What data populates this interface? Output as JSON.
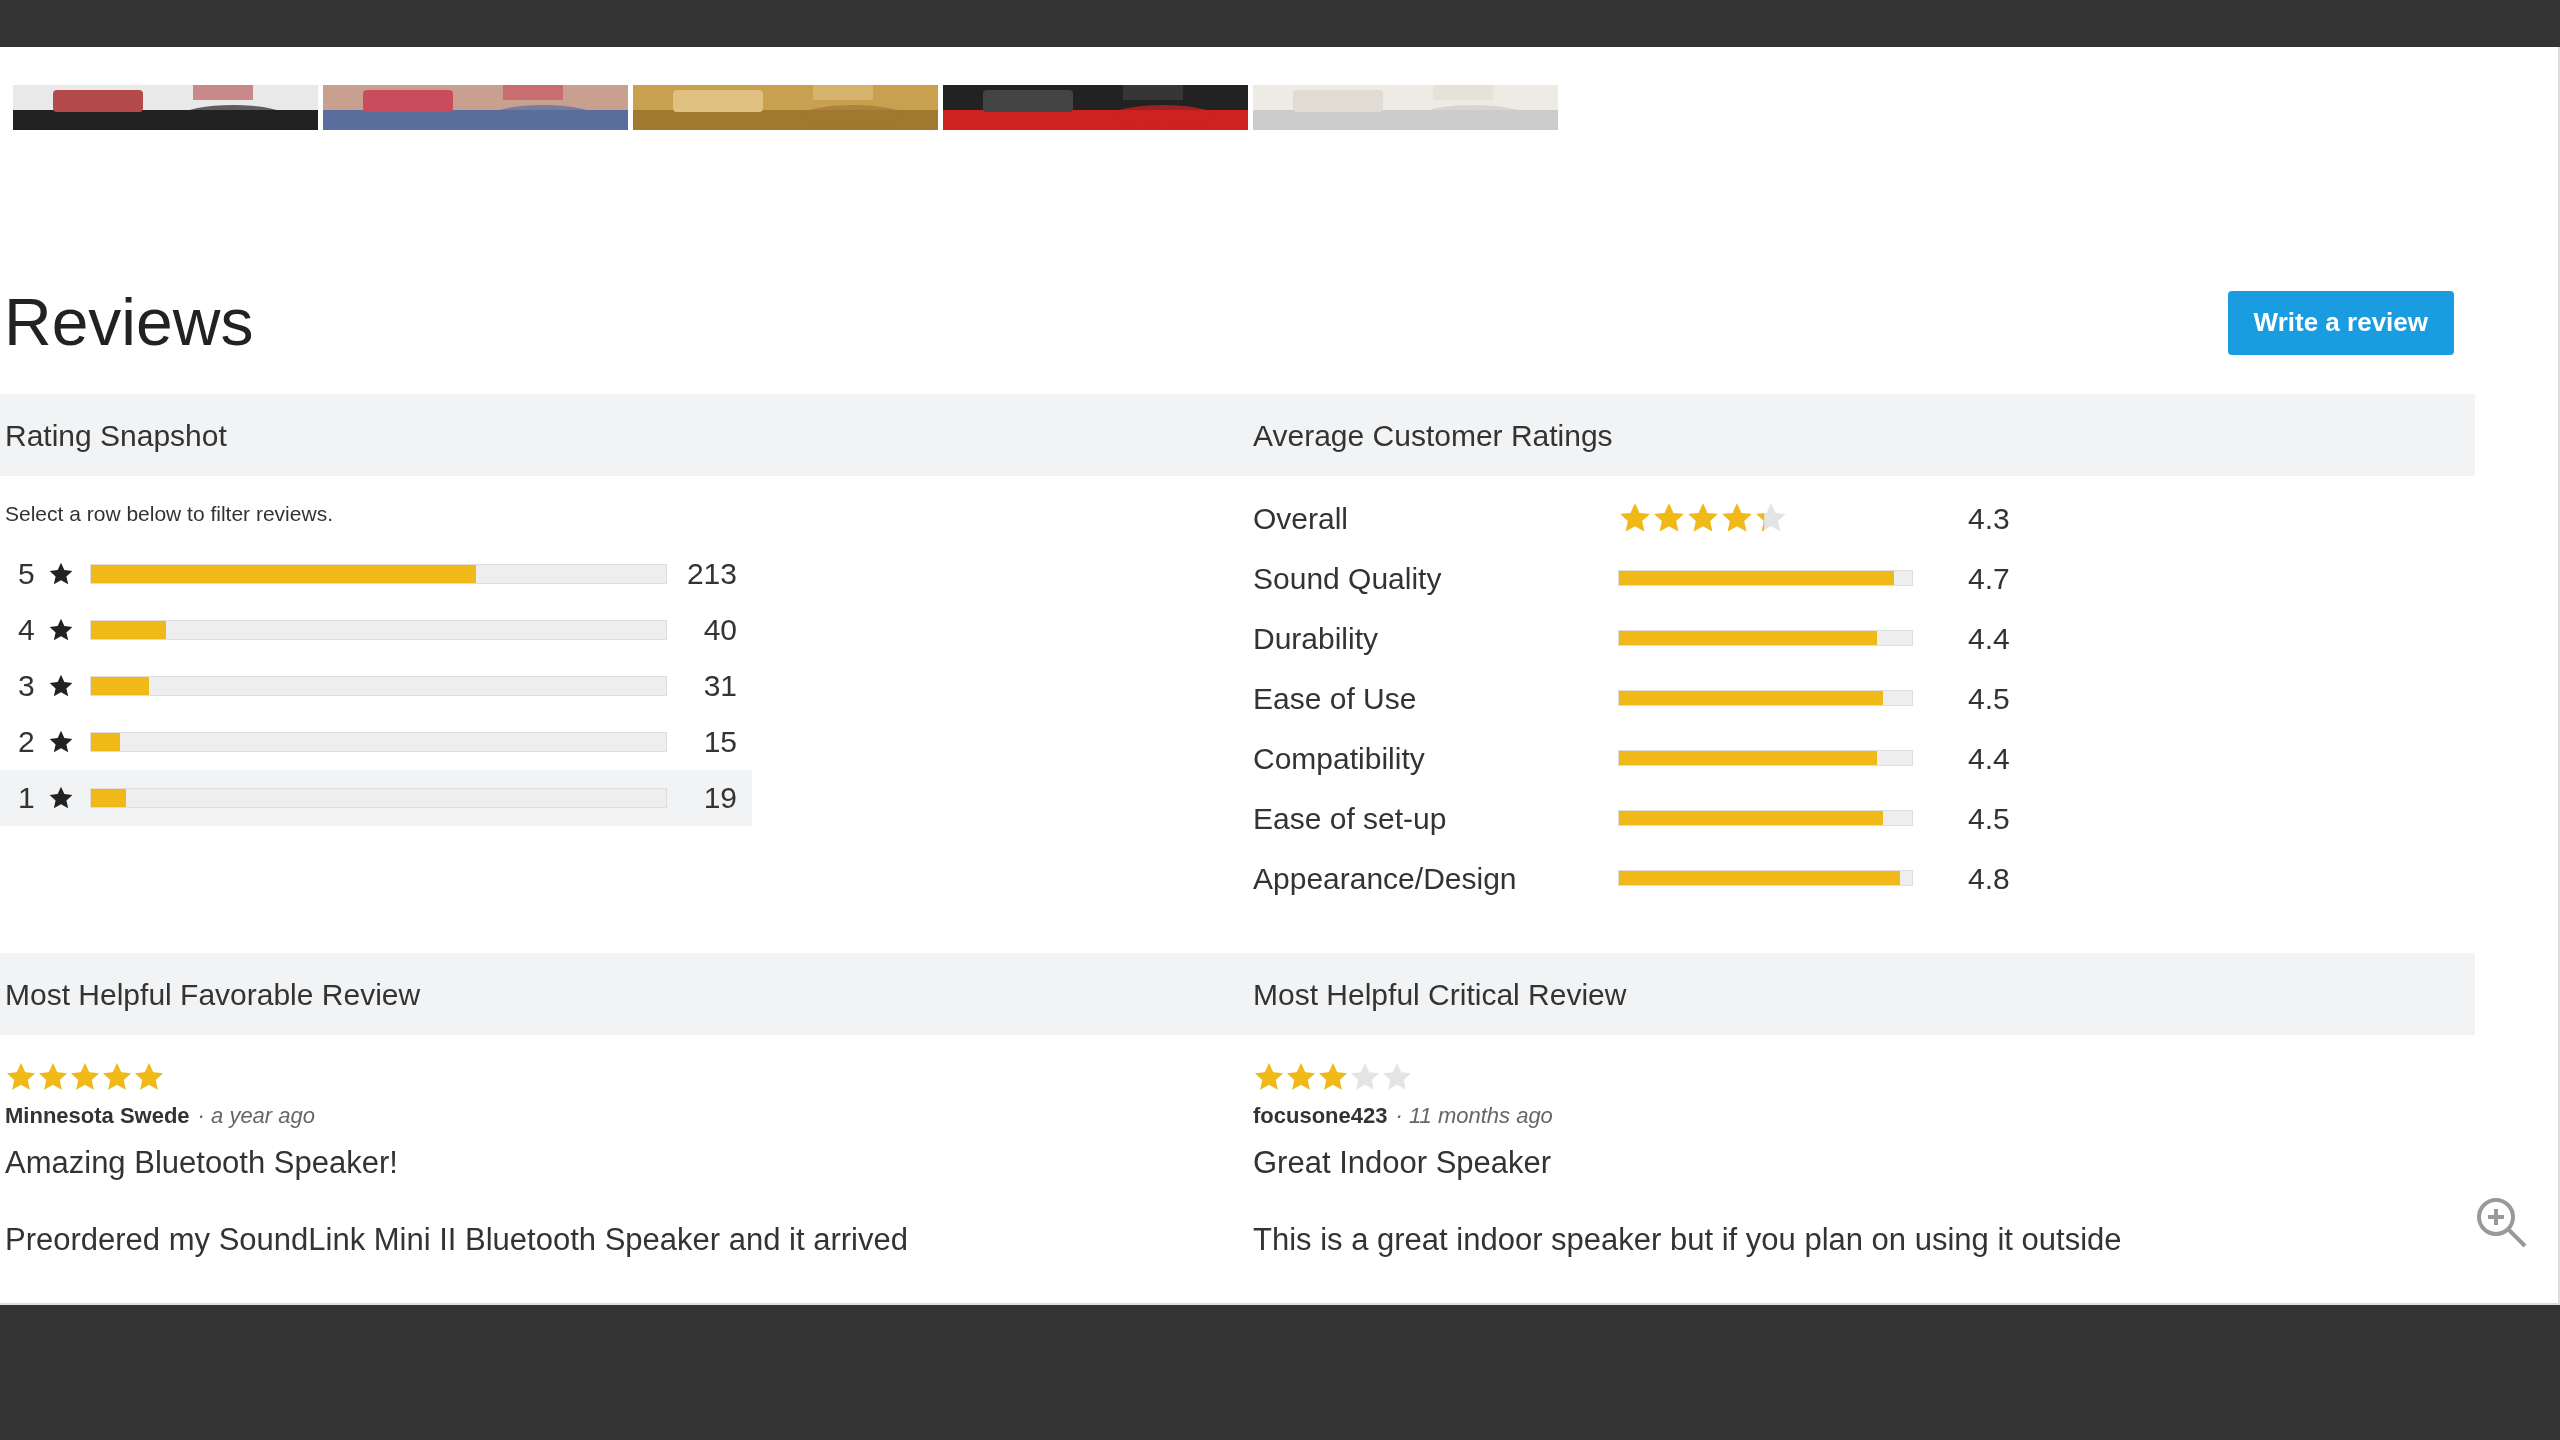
{
  "reviews": {
    "title": "Reviews",
    "write_button": "Write a review"
  },
  "rating_snapshot": {
    "heading": "Rating Snapshot",
    "hint": "Select a row below to filter reviews.",
    "rows": [
      {
        "label": "5",
        "count": "213",
        "level": 0.67,
        "selected": false
      },
      {
        "label": "4",
        "count": "40",
        "level": 0.13,
        "selected": false
      },
      {
        "label": "3",
        "count": "31",
        "level": 0.1,
        "selected": false
      },
      {
        "label": "2",
        "count": "15",
        "level": 0.05,
        "selected": false
      },
      {
        "label": "1",
        "count": "19",
        "level": 0.06,
        "selected": true
      }
    ]
  },
  "average_ratings": {
    "heading": "Average Customer Ratings",
    "rows": [
      {
        "kind": "stars",
        "label": "Overall",
        "stars": 4.3,
        "value": "4.3"
      },
      {
        "kind": "bar",
        "label": "Sound Quality",
        "level": 0.94,
        "value": "4.7"
      },
      {
        "kind": "bar",
        "label": "Durability",
        "level": 0.88,
        "value": "4.4"
      },
      {
        "kind": "bar",
        "label": "Ease of Use",
        "level": 0.9,
        "value": "4.5"
      },
      {
        "kind": "bar",
        "label": "Compatibility",
        "level": 0.88,
        "value": "4.4"
      },
      {
        "kind": "bar",
        "label": "Ease of set-up",
        "level": 0.9,
        "value": "4.5"
      },
      {
        "kind": "bar",
        "label": "Appearance/Design",
        "level": 0.96,
        "value": "4.8"
      }
    ]
  },
  "highlights": [
    {
      "heading": "Most Helpful Favorable Review",
      "stars": 5,
      "author": "Minnesota Swede",
      "time": "· a year ago",
      "title": "Amazing Bluetooth Speaker!",
      "body": "Preordered my SoundLink Mini II Bluetooth Speaker and it arrived"
    },
    {
      "heading": "Most Helpful Critical Review",
      "stars": 3,
      "author": "focusone423",
      "time": "· 11 months ago",
      "title": "Great Indoor Speaker",
      "body": "This is a great indoor speaker but if you plan on using it outside"
    }
  ]
}
